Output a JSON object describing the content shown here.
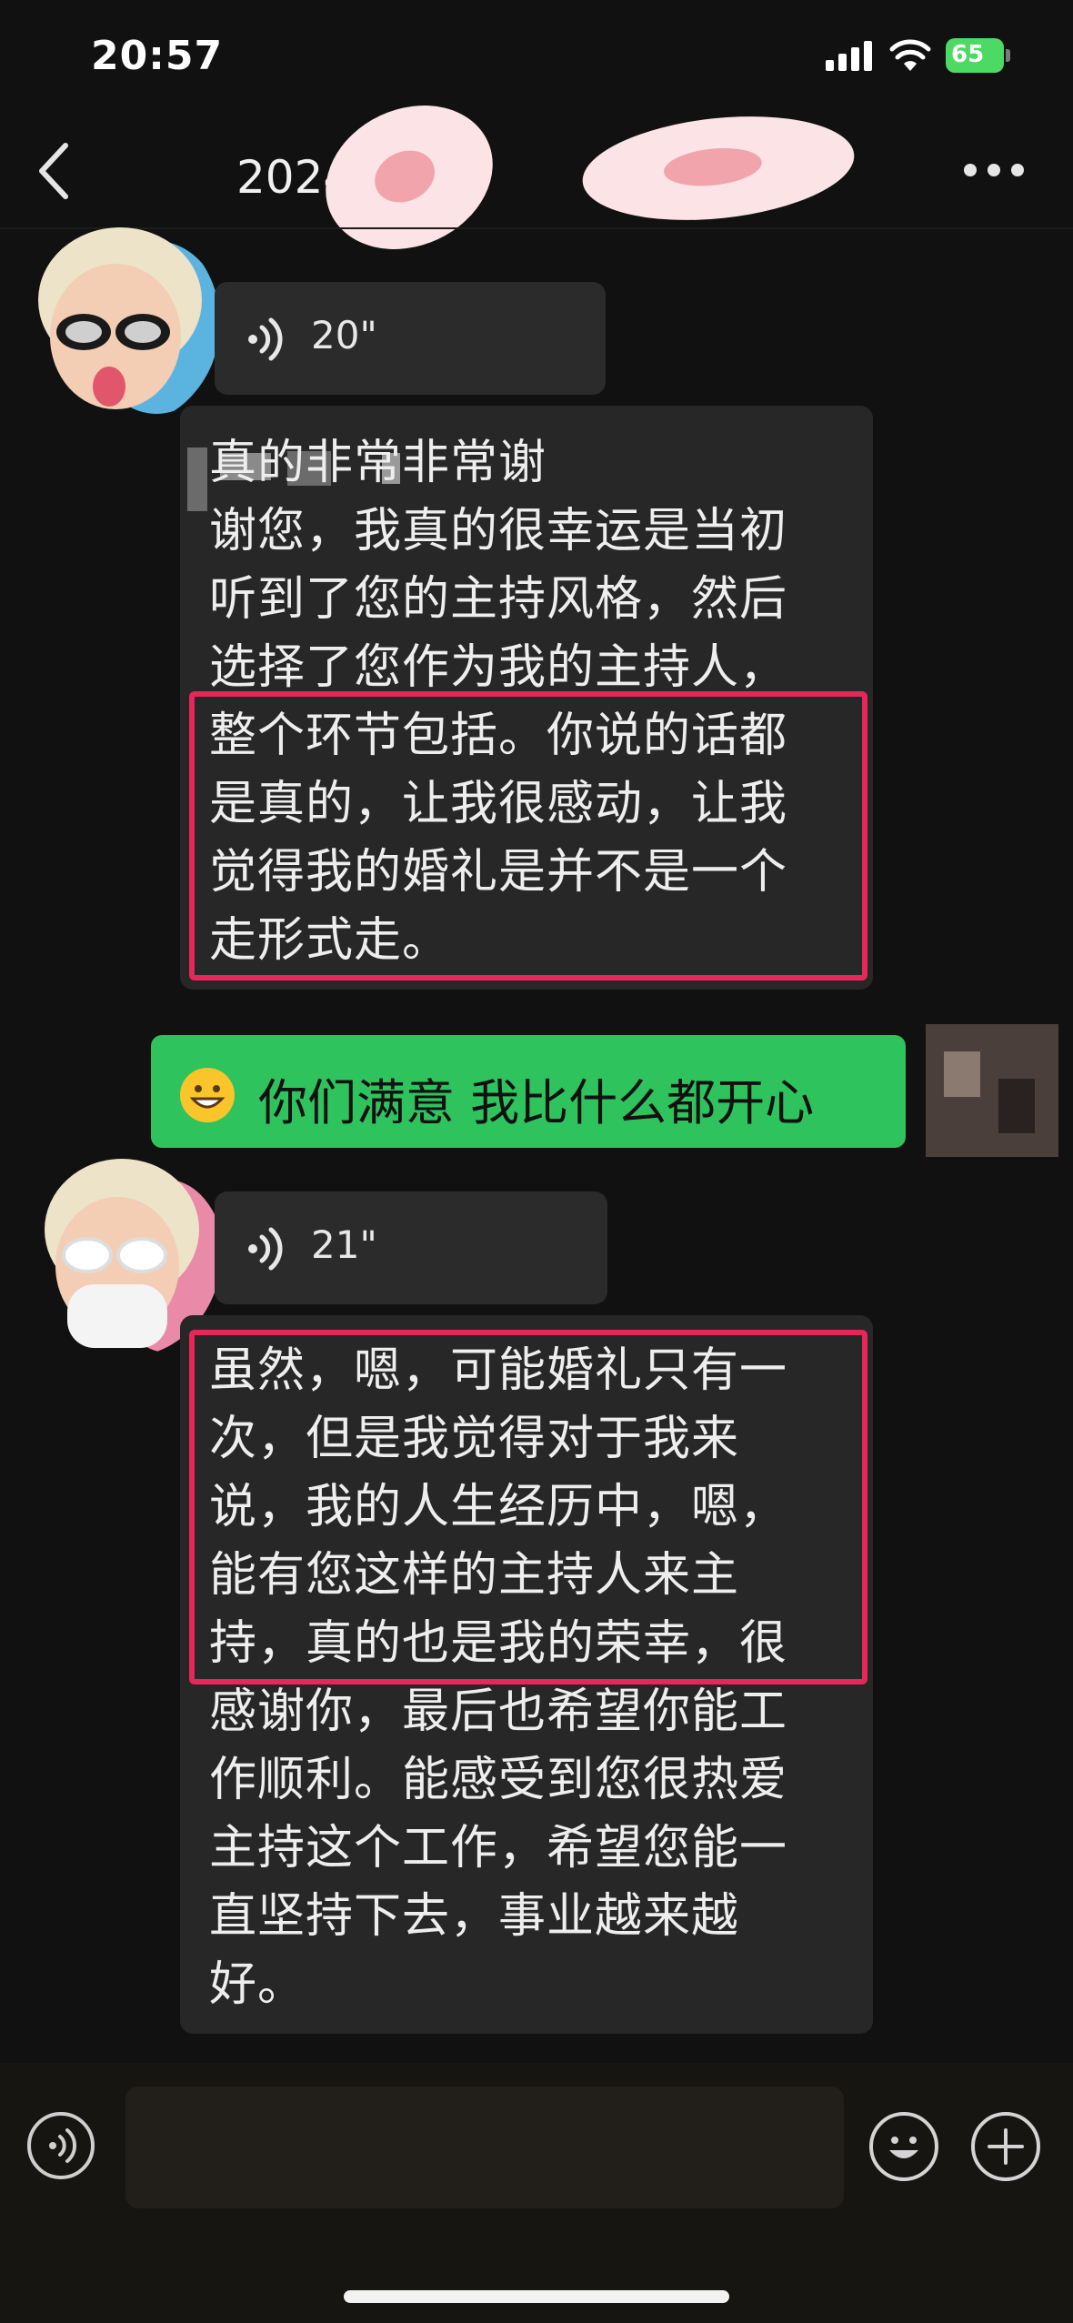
{
  "status_bar": {
    "time": "20:57",
    "battery": "65"
  },
  "nav": {
    "title": "2024 新娘"
  },
  "messages": [
    {
      "voice_duration": "20\""
    },
    {
      "text": "真的非常非常谢\n谢您，我真的很幸运是当初\n听到了您的主持风格，然后\n选择了您作为我的主持人，\n整个环节包括。你说的话都\n是真的，让我很感动，让我\n觉得我的婚礼是并不是一个\n走形式走。"
    },
    {
      "text": "你们满意 我比什么都开心"
    },
    {
      "voice_duration": "21\""
    },
    {
      "text": "虽然，嗯，可能婚礼只有一\n次，但是我觉得对于我来\n说，我的人生经历中，嗯，\n能有您这样的主持人来主\n持，真的也是我的荣幸，很\n感谢你，最后也希望你能工\n作顺利。能感受到您很热爱\n主持这个工作，希望您能一\n直坚持下去，事业越来越\n好。"
    }
  ],
  "colors": {
    "background": "#111111",
    "bubble": "#2b2b2b",
    "sent_bubble": "#2fc35e",
    "highlight": "#e8265a",
    "battery": "#4cd964"
  },
  "icons": [
    "back-arrow-icon",
    "more-dots-icon",
    "voice-wave-icon",
    "grin-emoji-icon",
    "voice-input-icon",
    "emoji-icon",
    "plus-icon"
  ]
}
